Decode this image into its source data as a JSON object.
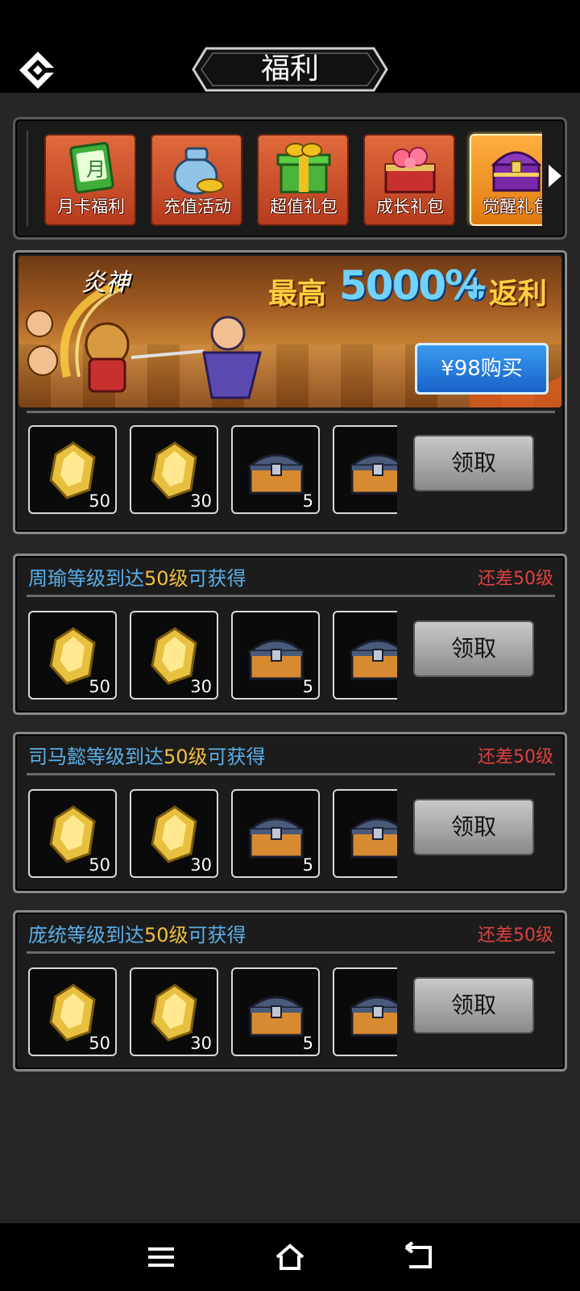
{
  "header": {
    "title": "福利",
    "logo_icon": "app-logo-icon"
  },
  "tabs": [
    {
      "label": "月卡福利",
      "icon": "month-card-icon",
      "active": false
    },
    {
      "label": "充值活动",
      "icon": "money-bag-icon",
      "active": false
    },
    {
      "label": "超值礼包",
      "icon": "green-gift-icon",
      "active": false
    },
    {
      "label": "成长礼包",
      "icon": "flower-box-icon",
      "active": false
    },
    {
      "label": "觉醒礼包",
      "icon": "purple-chest-icon",
      "active": true
    }
  ],
  "banner": {
    "tag": "炎神",
    "headline_prefix": "最高",
    "headline_value": "5000%",
    "headline_plus": "+",
    "headline_suffix": "返利",
    "buy_label": "¥98购买",
    "rewards": [
      {
        "icon": "gold-gem-icon",
        "count": "50"
      },
      {
        "icon": "gold-gem-icon",
        "count": "30"
      },
      {
        "icon": "treasure-chest-icon",
        "count": "5"
      },
      {
        "icon": "treasure-chest-icon",
        "count": ""
      }
    ],
    "claim_label": "领取"
  },
  "sections": [
    {
      "hero": "周瑜",
      "mid1": "等级到达",
      "level": "50级",
      "mid2": "可获得",
      "status": "还差50级",
      "rewards": [
        {
          "icon": "gold-gem-icon",
          "count": "50"
        },
        {
          "icon": "gold-gem-icon",
          "count": "30"
        },
        {
          "icon": "treasure-chest-icon",
          "count": "5"
        },
        {
          "icon": "treasure-chest-icon",
          "count": ""
        }
      ],
      "claim_label": "领取"
    },
    {
      "hero": "司马懿",
      "mid1": "等级到达",
      "level": "50级",
      "mid2": "可获得",
      "status": "还差50级",
      "rewards": [
        {
          "icon": "gold-gem-icon",
          "count": "50"
        },
        {
          "icon": "gold-gem-icon",
          "count": "30"
        },
        {
          "icon": "treasure-chest-icon",
          "count": "5"
        },
        {
          "icon": "treasure-chest-icon",
          "count": ""
        }
      ],
      "claim_label": "领取"
    },
    {
      "hero": "庞统",
      "mid1": "等级到达",
      "level": "50级",
      "mid2": "可获得",
      "status": "还差50级",
      "rewards": [
        {
          "icon": "gold-gem-icon",
          "count": "50"
        },
        {
          "icon": "gold-gem-icon",
          "count": "30"
        },
        {
          "icon": "treasure-chest-icon",
          "count": "5"
        },
        {
          "icon": "treasure-chest-icon",
          "count": ""
        }
      ],
      "claim_label": "领取"
    }
  ],
  "navbar": {
    "menu_icon": "menu-icon",
    "home_icon": "home-icon",
    "back_icon": "back-icon"
  },
  "colors": {
    "background": "#262626",
    "hero_name": "#5ab0e8",
    "level_text": "#f0c040",
    "status_red": "#e04040",
    "buy_button": "#1862c8"
  }
}
